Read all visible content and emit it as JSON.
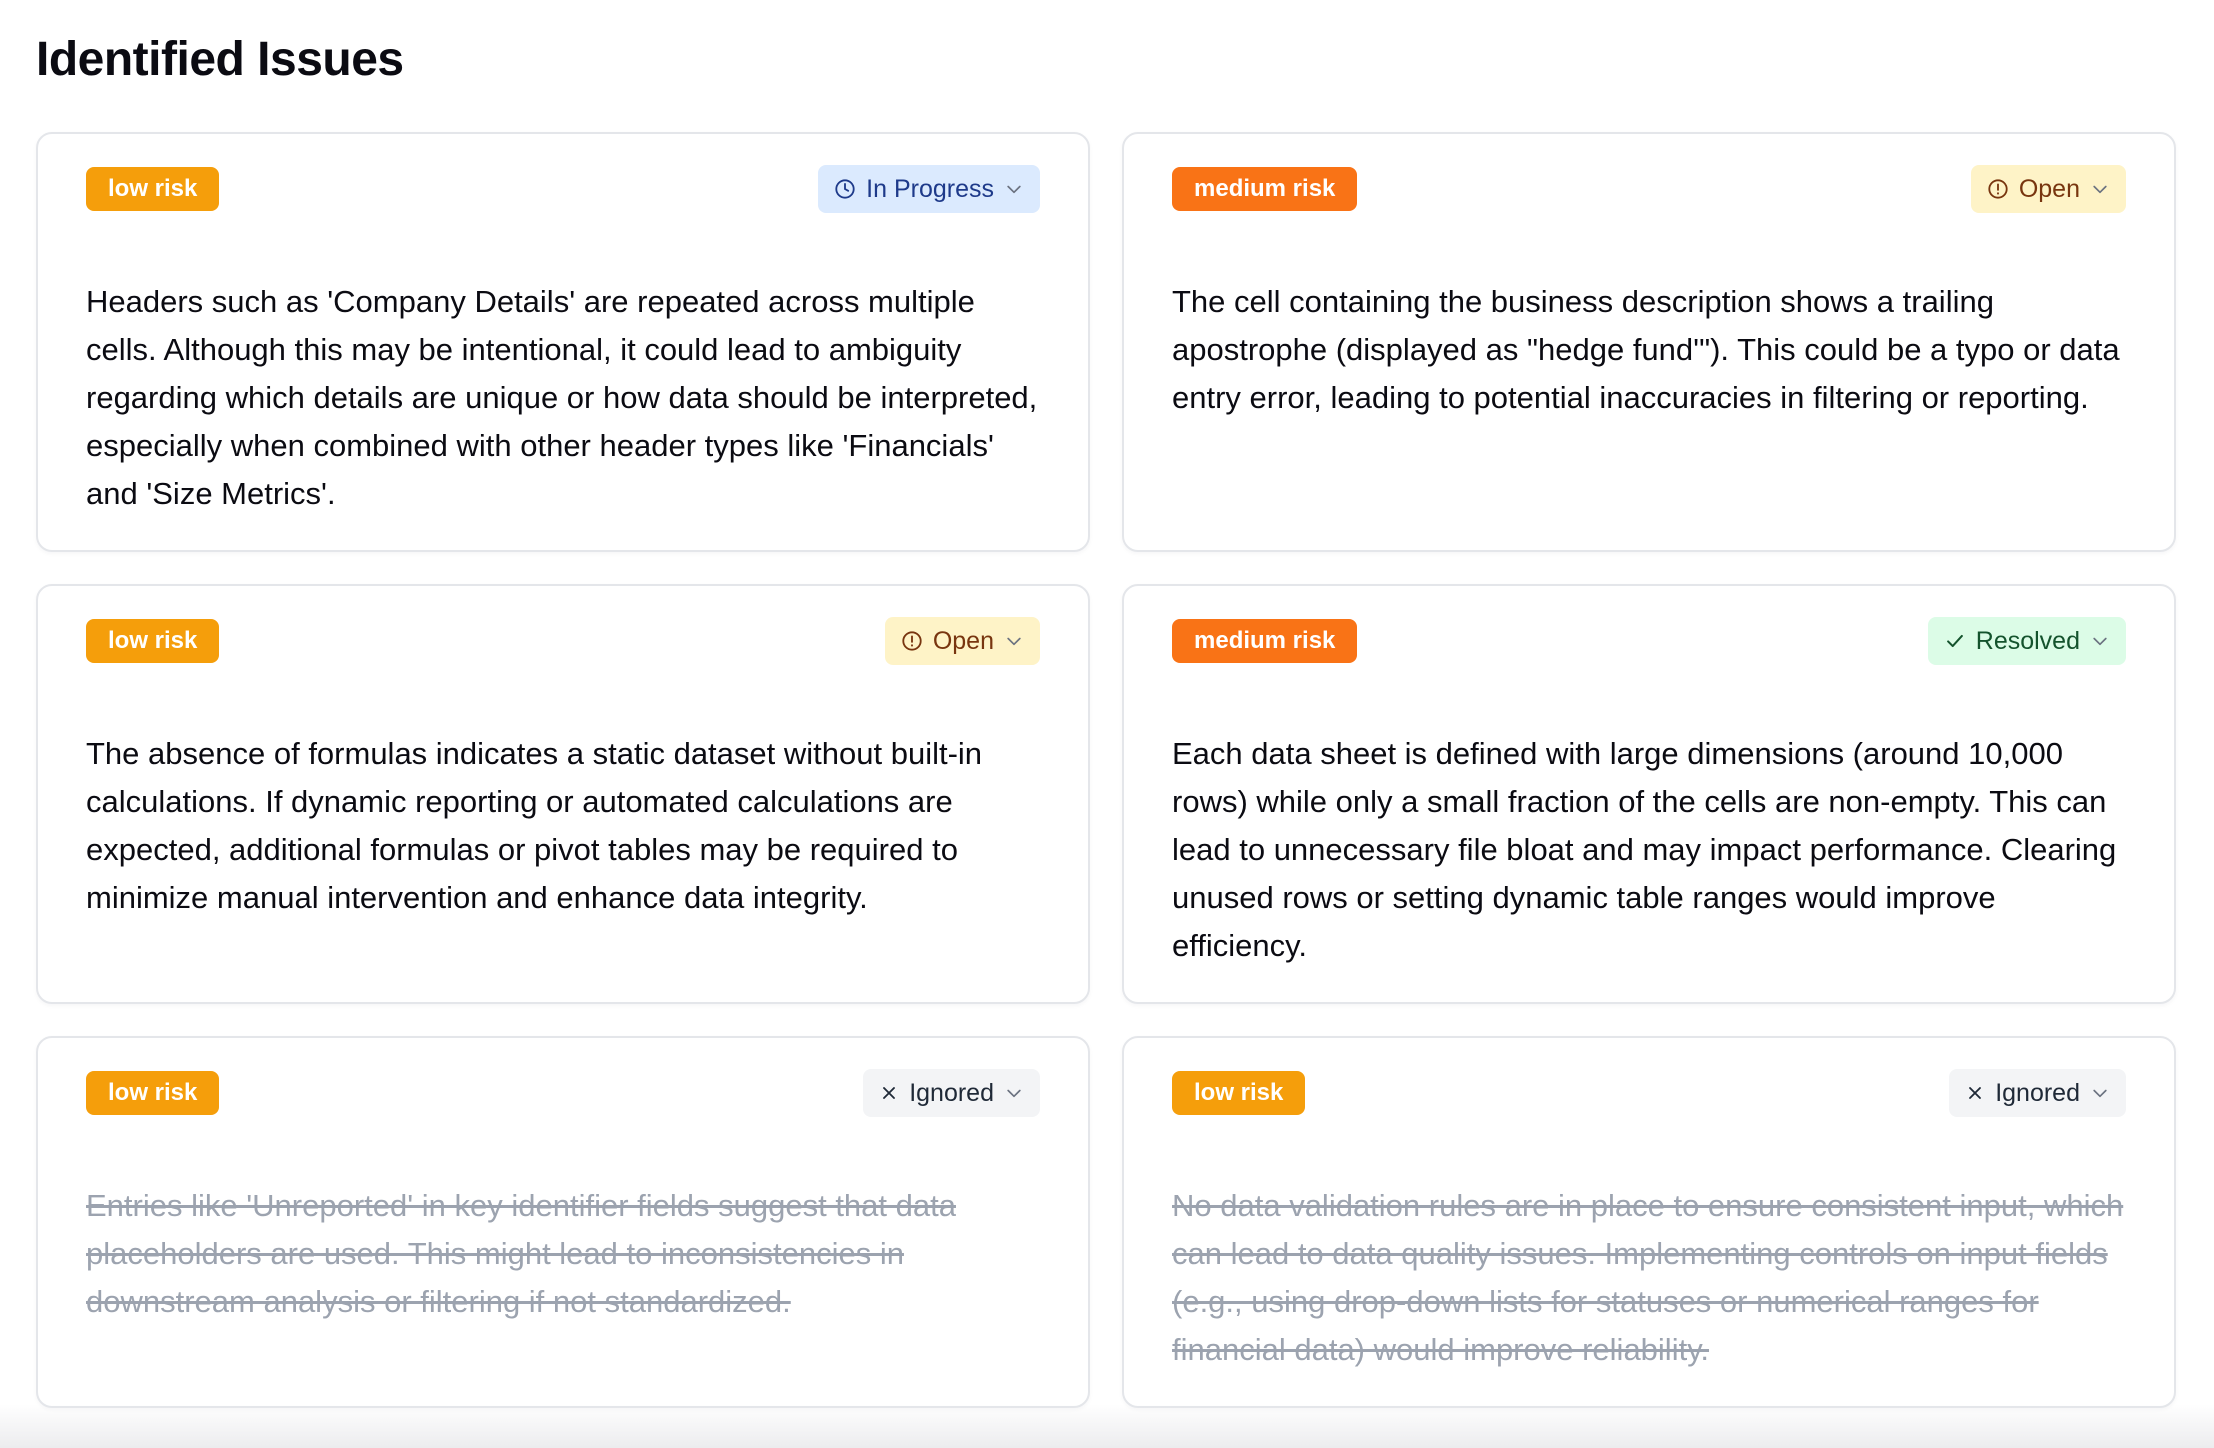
{
  "page": {
    "title": "Identified Issues"
  },
  "colors": {
    "low_risk": "#f59e0b",
    "medium_risk": "#f97316",
    "in_progress_bg": "#dbeafe",
    "open_bg": "#fef3c7",
    "resolved_bg": "#dcfce7",
    "ignored_bg": "#f3f4f6"
  },
  "issues": [
    {
      "risk": "low risk",
      "status": "In Progress",
      "status_icon": "clock-icon",
      "description": "Headers such as 'Company Details' are repeated across multiple cells. Although this may be intentional, it could lead to ambiguity regarding which details are unique or how data should be interpreted, especially when combined with other header types like 'Financials' and 'Size Metrics'."
    },
    {
      "risk": "medium risk",
      "status": "Open",
      "status_icon": "alert-circle-icon",
      "description": "The cell containing the business description shows a trailing apostrophe (displayed as \"hedge fund'\"). This could be a typo or data entry error, leading to potential inaccuracies in filtering or reporting."
    },
    {
      "risk": "low risk",
      "status": "Open",
      "status_icon": "alert-circle-icon",
      "description": "The absence of formulas indicates a static dataset without built-in calculations. If dynamic reporting or automated calculations are expected, additional formulas or pivot tables may be required to minimize manual intervention and enhance data integrity."
    },
    {
      "risk": "medium risk",
      "status": "Resolved",
      "status_icon": "check-icon",
      "description": "Each data sheet is defined with large dimensions (around 10,000 rows) while only a small fraction of the cells are non-empty. This can lead to unnecessary file bloat and may impact performance. Clearing unused rows or setting dynamic table ranges would improve efficiency."
    },
    {
      "risk": "low risk",
      "status": "Ignored",
      "status_icon": "x-icon",
      "description": "Entries like 'Unreported' in key identifier fields suggest that data placeholders are used. This might lead to inconsistencies in downstream analysis or filtering if not standardized."
    },
    {
      "risk": "low risk",
      "status": "Ignored",
      "status_icon": "x-icon",
      "description": "No data validation rules are in place to ensure consistent input, which can lead to data quality issues. Implementing controls on input fields (e.g., using drop-down lists for statuses or numerical ranges for financial data) would improve reliability."
    }
  ]
}
